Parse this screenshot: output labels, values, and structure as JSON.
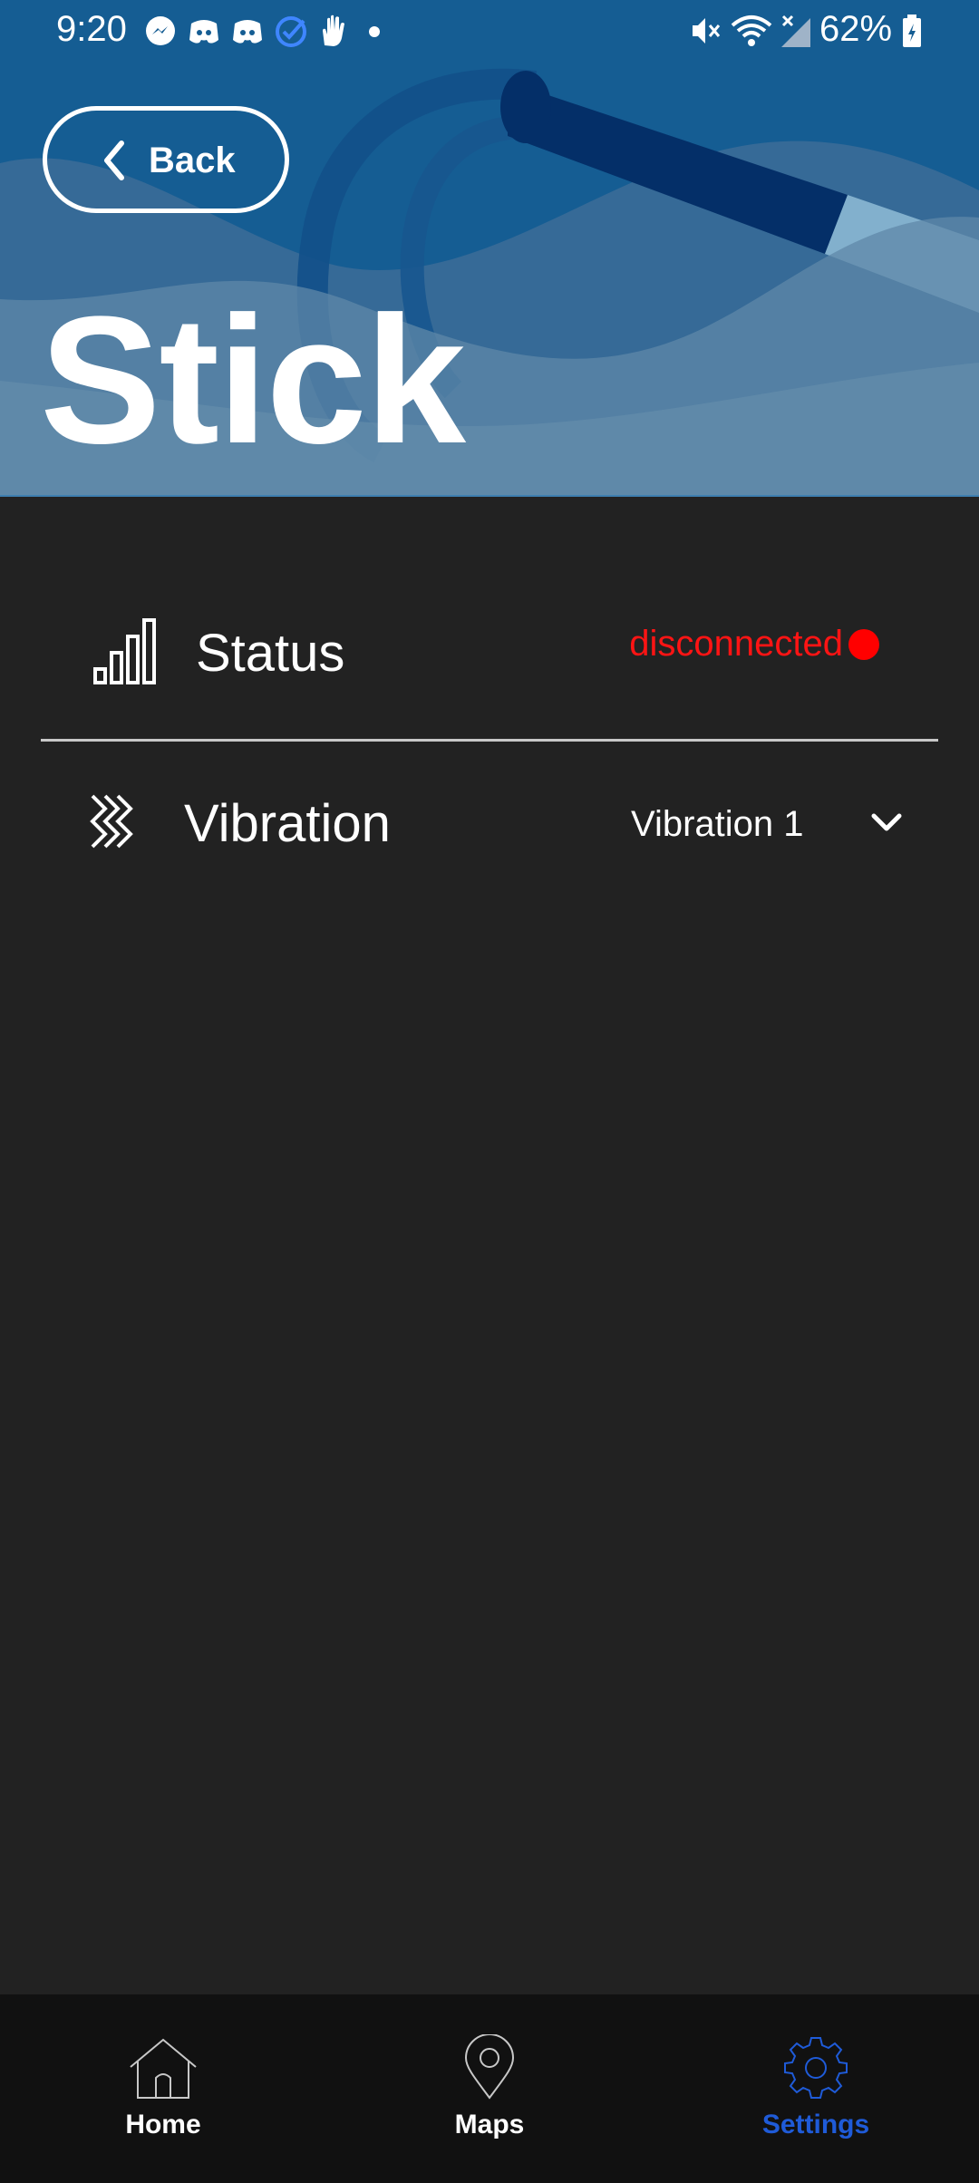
{
  "status_bar": {
    "time": "9:20",
    "battery": "62%",
    "notification_icons": [
      "messenger-icon",
      "discord-icon",
      "discord-icon",
      "check-circle-icon",
      "hand-icon",
      "dot-icon"
    ],
    "system_icons": [
      "mute-icon",
      "wifi-icon",
      "signal-icon",
      "battery-icon"
    ]
  },
  "header": {
    "back_label": "Back",
    "title": "Stick"
  },
  "rows": {
    "status": {
      "label": "Status",
      "value": "disconnected",
      "value_color": "#ff1414",
      "icon": "signal-bars-icon"
    },
    "vibration": {
      "label": "Vibration",
      "selected": "Vibration 1",
      "icon": "vibration-icon"
    }
  },
  "bottom_nav": {
    "items": [
      {
        "label": "Home",
        "icon": "home-icon",
        "active": false
      },
      {
        "label": "Maps",
        "icon": "map-pin-icon",
        "active": false
      },
      {
        "label": "Settings",
        "icon": "gear-icon",
        "active": true
      }
    ],
    "active_color": "#1f5bd8"
  }
}
